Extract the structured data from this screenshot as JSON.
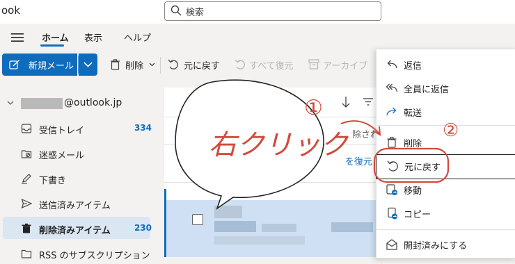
{
  "app": {
    "title": "ook"
  },
  "search": {
    "placeholder": "検索"
  },
  "ribbon": {
    "tabs": [
      "ホーム",
      "表示",
      "ヘルプ"
    ]
  },
  "toolbar": {
    "new_mail": "新規メール",
    "delete": "削除",
    "undo": "元に戻す",
    "restore_all": "すべて復元",
    "archive": "アーカイブ"
  },
  "nav": {
    "account": "@outlook.jp",
    "items": [
      {
        "label": "受信トレイ",
        "count": "334",
        "icon": "inbox-icon"
      },
      {
        "label": "迷惑メール",
        "count": "",
        "icon": "junk-folder-icon"
      },
      {
        "label": "下書き",
        "count": "",
        "icon": "pencil-icon"
      },
      {
        "label": "送信済みアイテム",
        "count": "",
        "icon": "send-icon"
      },
      {
        "label": "削除済みアイテム",
        "count": "230",
        "icon": "trash-icon"
      },
      {
        "label": "RSS のサブスクリプション",
        "count": "",
        "icon": "folder-icon"
      }
    ]
  },
  "list": {
    "partial_texts": [
      "除され",
      "を復元"
    ]
  },
  "context_menu": {
    "items": [
      {
        "label": "返信",
        "icon": "reply-icon"
      },
      {
        "label": "全員に返信",
        "icon": "reply-all-icon"
      },
      {
        "label": "転送",
        "icon": "forward-icon"
      },
      {
        "label": "削除",
        "icon": "trash-icon"
      },
      {
        "label": "元に戻す",
        "icon": "undo-icon"
      },
      {
        "label": "移動",
        "icon": "move-icon"
      },
      {
        "label": "コピー",
        "icon": "copy-icon"
      },
      {
        "label": "開封済みにする",
        "icon": "mail-open-icon"
      }
    ]
  },
  "annotations": {
    "bubble_text": "右クリック",
    "step1": "①",
    "step2": "②"
  },
  "colors": {
    "accent": "#0f6cbd",
    "annotation": "#d24a3b"
  }
}
